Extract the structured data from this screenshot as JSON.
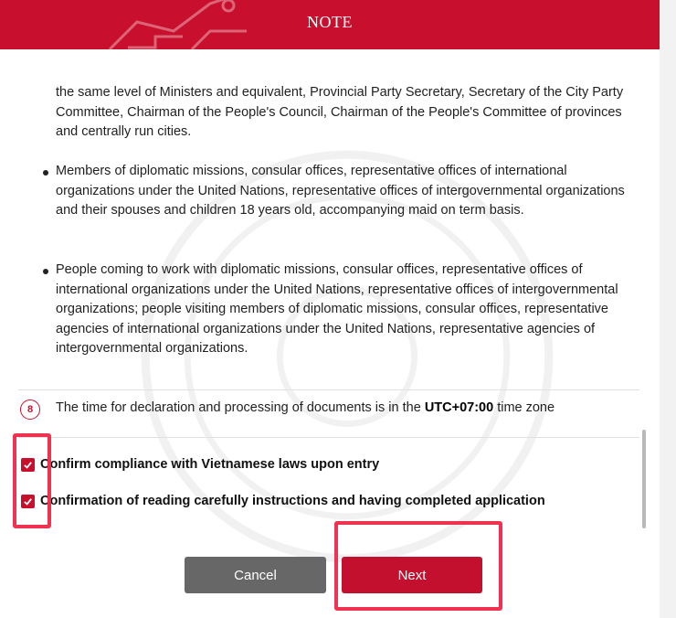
{
  "header": {
    "title": "NOTE"
  },
  "content": {
    "para_continued": "the same level of Ministers and equivalent, Provincial Party Secretary, Secretary of the City Party Committee, Chairman of the People's Council, Chairman of the People's Committee of provinces and centrally run cities.",
    "bullets": [
      "Members of diplomatic missions, consular offices, representative offices of international organizations under the United Nations, representative offices of intergovernmental organizations and their spouses and children 18 years old, accompanying maid on term basis.",
      "People coming to work with diplomatic missions, consular offices, representative offices of international organizations under the United Nations, representative offices of intergovernmental organizations; people visiting members of diplomatic missions, consular offices, representative agencies of international organizations under the United Nations, representative agencies of intergovernmental organizations."
    ],
    "step": {
      "number": "8",
      "text_before": "The time for declaration and processing of documents is in the ",
      "timezone": "UTC+07:00",
      "text_after": " time zone"
    }
  },
  "confirmations": [
    {
      "label": "Confirm compliance with Vietnamese laws upon entry",
      "checked": true
    },
    {
      "label": "Confirmation of reading carefully instructions and having completed application",
      "checked": true
    }
  ],
  "buttons": {
    "cancel": "Cancel",
    "next": "Next"
  },
  "colors": {
    "brand_red": "#c8102e",
    "cancel_gray": "#676767",
    "highlight": "#f0314f"
  }
}
